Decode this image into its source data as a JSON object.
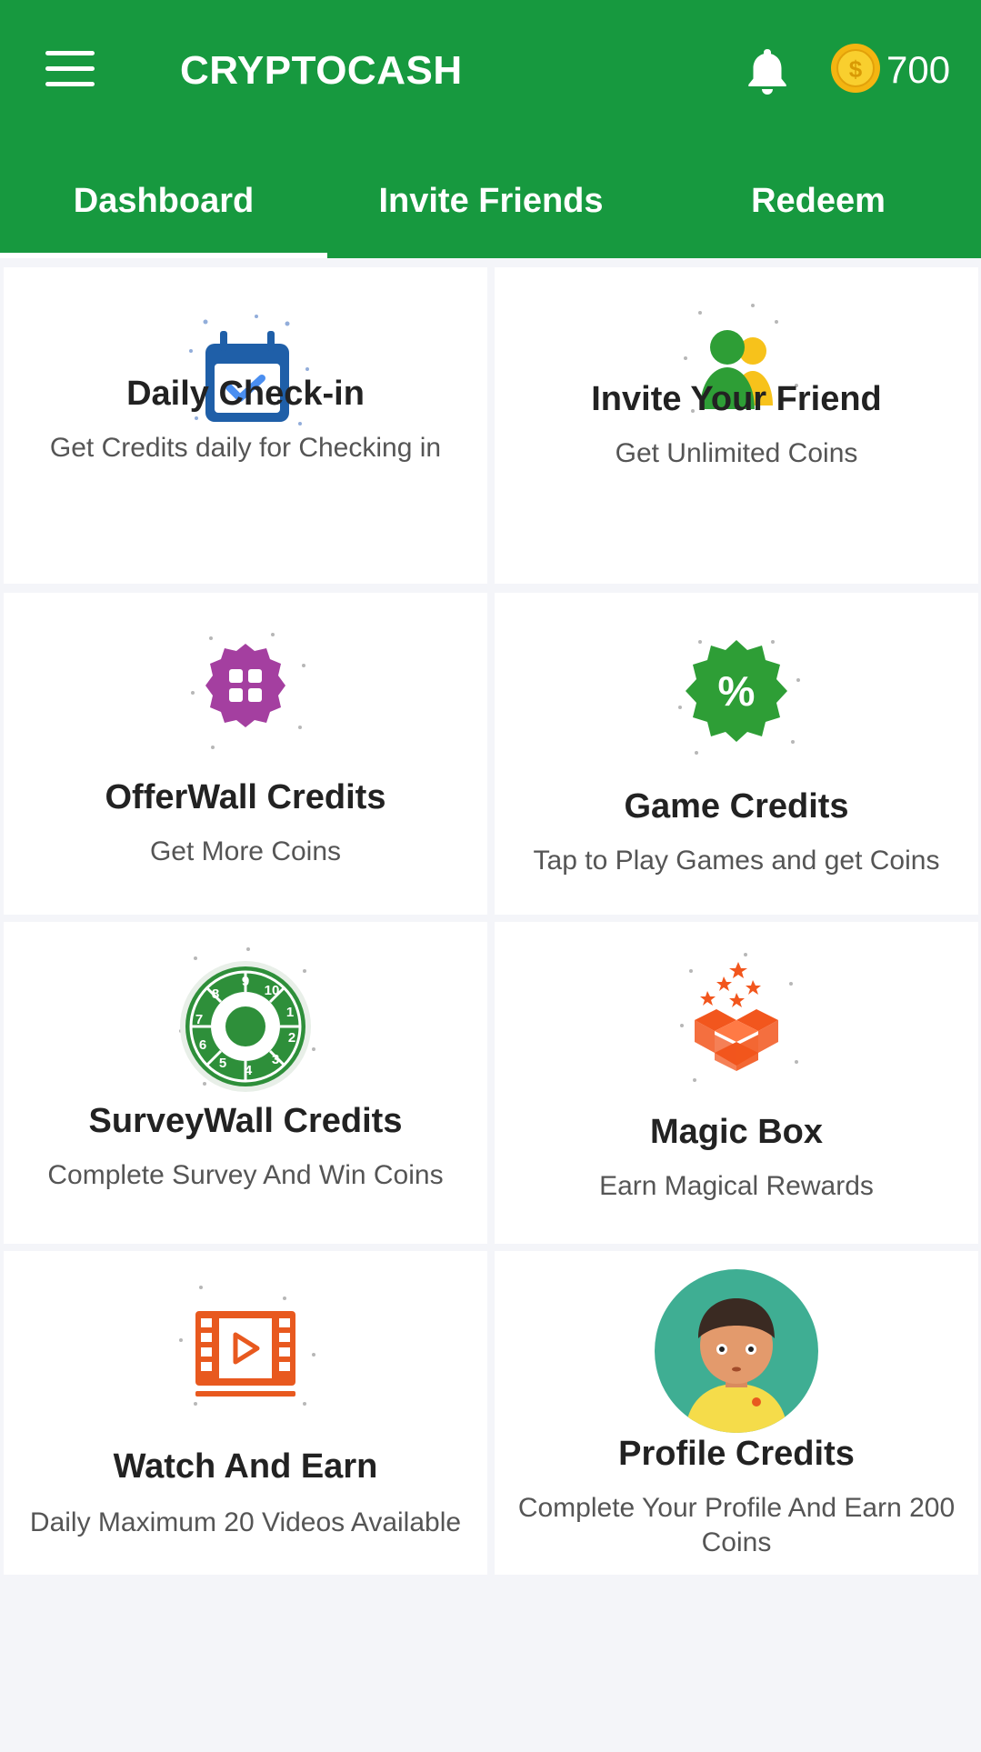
{
  "app": {
    "title": "CRYPTOCASH",
    "coin_count": "700",
    "coin_symbol": "$"
  },
  "tabs": [
    {
      "label": "Dashboard",
      "active": true
    },
    {
      "label": "Invite Friends",
      "active": false
    },
    {
      "label": "Redeem",
      "active": false
    }
  ],
  "cards": [
    {
      "title": "Daily Check-in",
      "subtitle": "Get Credits daily for Checking in",
      "icon": "calendar-check-icon"
    },
    {
      "title": "Invite Your Friend",
      "subtitle": "Get Unlimited Coins",
      "icon": "friends-icon"
    },
    {
      "title": "OfferWall Credits",
      "subtitle": "Get More Coins",
      "icon": "offerwall-badge-icon"
    },
    {
      "title": "Game Credits",
      "subtitle": "Tap to Play Games and get Coins",
      "icon": "percent-badge-icon"
    },
    {
      "title": "SurveyWall Credits",
      "subtitle": "Complete Survey And Win Coins",
      "icon": "survey-wheel-icon"
    },
    {
      "title": "Magic Box",
      "subtitle": "Earn Magical Rewards",
      "icon": "magic-box-icon"
    },
    {
      "title": "Watch And Earn",
      "subtitle": "Daily Maximum 20 Videos Available",
      "icon": "video-film-icon"
    },
    {
      "title": "Profile Credits",
      "subtitle": "Complete Your Profile And Earn 200 Coins",
      "icon": "profile-avatar-icon"
    }
  ],
  "colors": {
    "primary": "#17993f",
    "coin": "#f7c21b",
    "calendar": "#1f5fa8",
    "offerwall": "#a43fa0",
    "game": "#2e9e36",
    "magic": "#f2561d",
    "video": "#e8591f",
    "avatar_bg": "#3fae93"
  }
}
